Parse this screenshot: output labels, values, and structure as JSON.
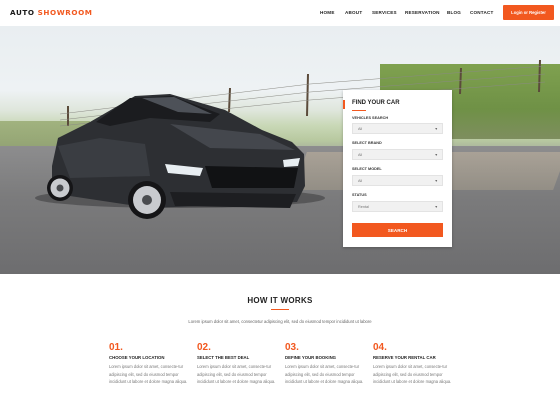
{
  "header": {
    "logo_part1": "AUTO",
    "logo_part2": "SHOWROOM",
    "nav": [
      "HOME",
      "ABOUT",
      "SERVICES",
      "RESERVATION",
      "BLOG",
      "CONTACT"
    ],
    "login_label": "Login or Register"
  },
  "colors": {
    "accent": "#f2581f",
    "text": "#222222",
    "muted": "#777777"
  },
  "search": {
    "title": "FIND YOUR CAR",
    "fields": [
      {
        "label": "VEHICLES SEARCH",
        "value": "All"
      },
      {
        "label": "SELECT BRAND",
        "value": "All"
      },
      {
        "label": "SELECT MODEL",
        "value": "All"
      },
      {
        "label": "STATUS",
        "value": "Rental"
      }
    ],
    "button_label": "SEARCH"
  },
  "how_it_works": {
    "title": "HOW IT WORKS",
    "subtitle": "Lorem ipsum dolor sit amet, consectetur adipiscing elit, sed do eiusmod tempor incididunt ut labore",
    "steps": [
      {
        "num": "01.",
        "title": "CHOOSE YOUR LOCATION",
        "text": "Lorem ipsum dolor sit amet, consecte-tur adipiscing elit, sed do eiusmod tempor incididunt ut labore et dolore magna aliqua."
      },
      {
        "num": "02.",
        "title": "SELECT THE BEST DEAL",
        "text": "Lorem ipsum dolor sit amet, consecte-tur adipiscing elit, sed do eiusmod tempor incididunt ut labore et dolore magna aliqua."
      },
      {
        "num": "03.",
        "title": "DEFINE YOUR BOOKING",
        "text": "Lorem ipsum dolor sit amet, consecte-tur adipiscing elit, sed do eiusmod tempor incididunt ut labore et dolore magna aliqua."
      },
      {
        "num": "04.",
        "title": "RESERVE YOUR RENTAL CAR",
        "text": "Lorem ipsum dolor sit amet, consecte-tur adipiscing elit, sed do eiusmod tempor incididunt ut labore et dolore magna aliqua."
      }
    ]
  }
}
